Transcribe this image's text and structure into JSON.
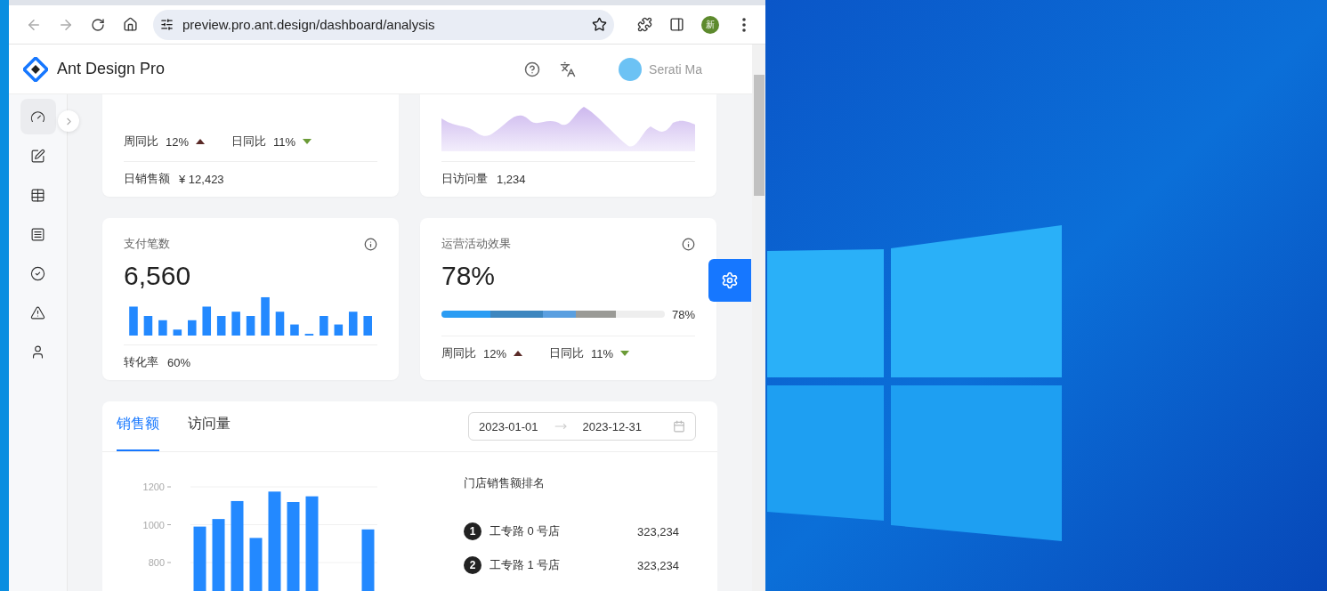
{
  "browser": {
    "url": "preview.pro.ant.design/dashboard/analysis",
    "profile_initial": "新"
  },
  "header": {
    "app_name": "Ant Design Pro",
    "user_name": "Serati Ma"
  },
  "sidebar": {
    "items": [
      {
        "selected": true
      },
      {
        "selected": false
      },
      {
        "selected": false
      },
      {
        "selected": false
      },
      {
        "selected": false
      },
      {
        "selected": false
      },
      {
        "selected": false
      }
    ]
  },
  "cards": [
    {
      "kind": "trends",
      "trends": [
        {
          "label": "周同比",
          "value": "12%",
          "rising": true
        },
        {
          "label": "日同比",
          "value": "11%",
          "rising": false
        }
      ],
      "footer_label": "日销售额",
      "footer_value": "¥ 12,423"
    },
    {
      "kind": "area",
      "footer_label": "日访问量",
      "footer_value": "1,234"
    },
    {
      "kind": "bars",
      "title": "支付笔数",
      "value": "6,560",
      "footer_label": "转化率",
      "footer_value": "60%"
    },
    {
      "kind": "progress",
      "title": "运营活动效果",
      "value": "78%",
      "level": 0.78,
      "progress_label": "78%",
      "trends": [
        {
          "label": "周同比",
          "value": "12%",
          "rising": true
        },
        {
          "label": "日同比",
          "value": "11%",
          "rising": false
        }
      ]
    }
  ],
  "sales": {
    "tabs": [
      {
        "label": "销售额",
        "selected": true
      },
      {
        "label": "访问量",
        "selected": false
      }
    ],
    "date_range": {
      "start": "2023-01-01",
      "end": "2023-12-31"
    },
    "chart_data": {
      "type": "bar",
      "ylim": [
        0,
        1200
      ],
      "yticks": [
        800,
        1000,
        1200
      ],
      "grid": true,
      "series": [
        {
          "color": "#2389ff",
          "values": [
            990,
            1030,
            1125,
            930,
            1175,
            1120,
            1150,
            null,
            null,
            975
          ]
        }
      ]
    },
    "ranking": {
      "title": "门店销售额排名",
      "items": [
        {
          "rank": "1",
          "name": "工专路 0 号店",
          "value": "323,234"
        },
        {
          "rank": "2",
          "name": "工专路 1 号店",
          "value": "323,234"
        }
      ]
    }
  }
}
